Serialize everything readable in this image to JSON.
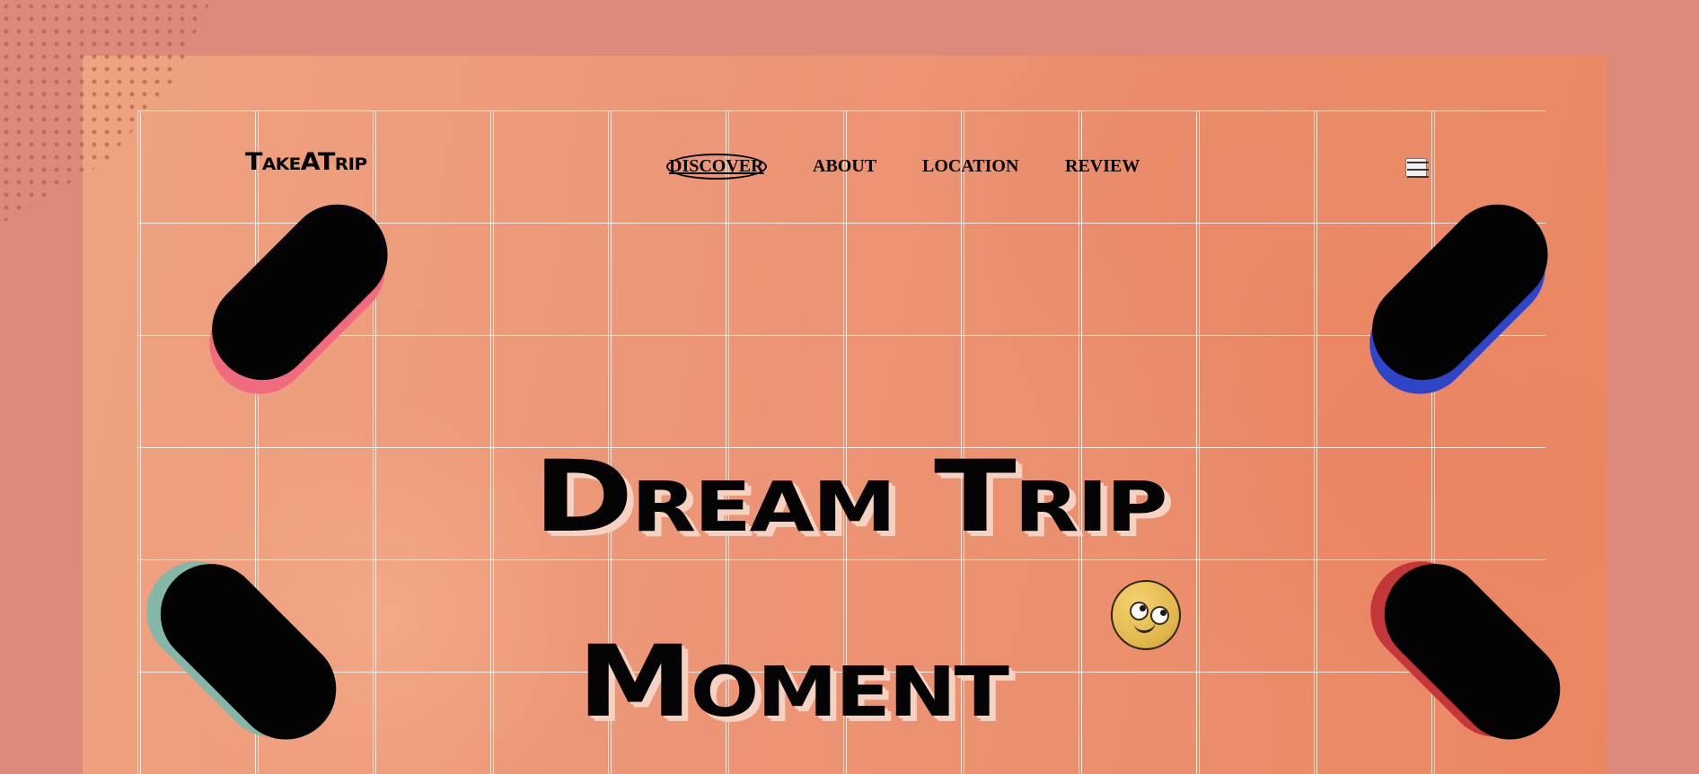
{
  "brand": {
    "name": "TakeATrip"
  },
  "navigation": {
    "items": [
      {
        "label": "DISCOVER"
      },
      {
        "label": "ABOUT"
      },
      {
        "label": "LOCATION"
      },
      {
        "label": "REVIEW"
      }
    ],
    "menu_icon": "hamburger-menu-icon"
  },
  "hero": {
    "headline_line_1": "Dream Trip",
    "headline_line_2": "Moment",
    "emoji_icon": "rolling-eyes-emoji-icon"
  },
  "colors": {
    "outer_background": "#dc8a7c",
    "hero_background": "#ec9677",
    "pink_pill": "#f16b7f",
    "blue_pill": "#2f45c8",
    "teal_pill": "#84b7a8",
    "red_pill": "#c43739",
    "headline_shadow": "#f6d2c3"
  }
}
